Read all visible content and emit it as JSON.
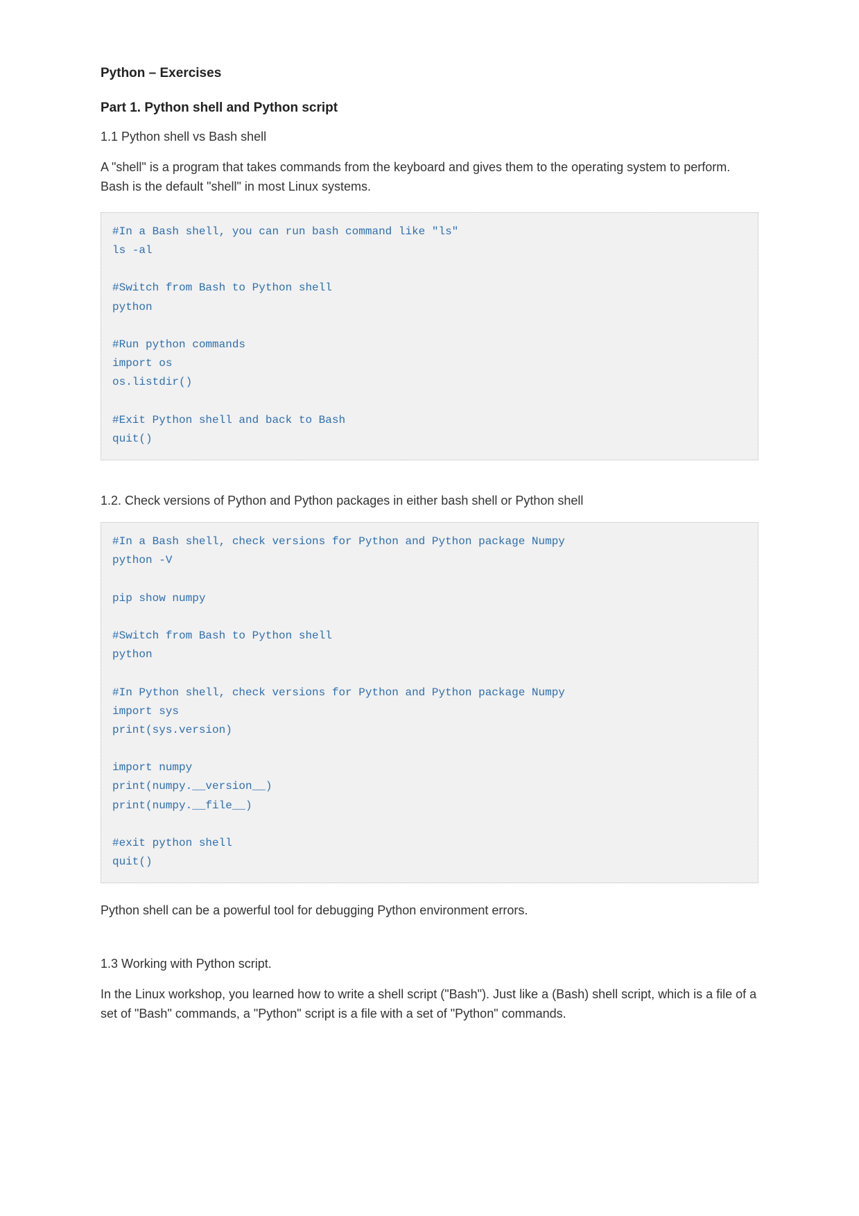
{
  "title": "Python – Exercises",
  "part1": {
    "heading": "Part 1. Python shell and Python script",
    "s11": {
      "heading": "1.1 Python shell vs Bash shell",
      "intro": "A \"shell\" is a program that takes commands from the keyboard and gives them to the operating system to perform. Bash is the default \"shell\" in most Linux systems.",
      "code": [
        "#In a Bash shell, you can run bash command like \"ls\"",
        "ls -al",
        "",
        "#Switch from Bash to Python shell",
        "python",
        "",
        "#Run python commands",
        "import os",
        "os.listdir()",
        "",
        "#Exit Python shell and back to Bash",
        "quit()"
      ]
    },
    "s12": {
      "heading": "1.2. Check versions of Python and Python packages in either bash shell or Python shell",
      "code": [
        "#In a Bash shell, check versions for Python and Python package Numpy",
        "python -V",
        "",
        "pip show numpy",
        "",
        "#Switch from Bash to Python shell",
        "python",
        "",
        "#In Python shell, check versions for Python and Python package Numpy",
        "import sys",
        "print(sys.version)",
        "",
        "import numpy",
        "print(numpy.__version__)",
        "print(numpy.__file__)",
        "",
        "#exit python shell",
        "quit()"
      ],
      "outro": "Python shell can be a powerful tool for debugging Python environment errors."
    },
    "s13": {
      "heading": "1.3 Working with Python script.",
      "para": "In the Linux workshop, you learned how to write a shell script (\"Bash\"). Just like a (Bash) shell script, which is a file of a set of \"Bash\" commands, a \"Python\" script is a file with a set of \"Python\" commands."
    }
  }
}
